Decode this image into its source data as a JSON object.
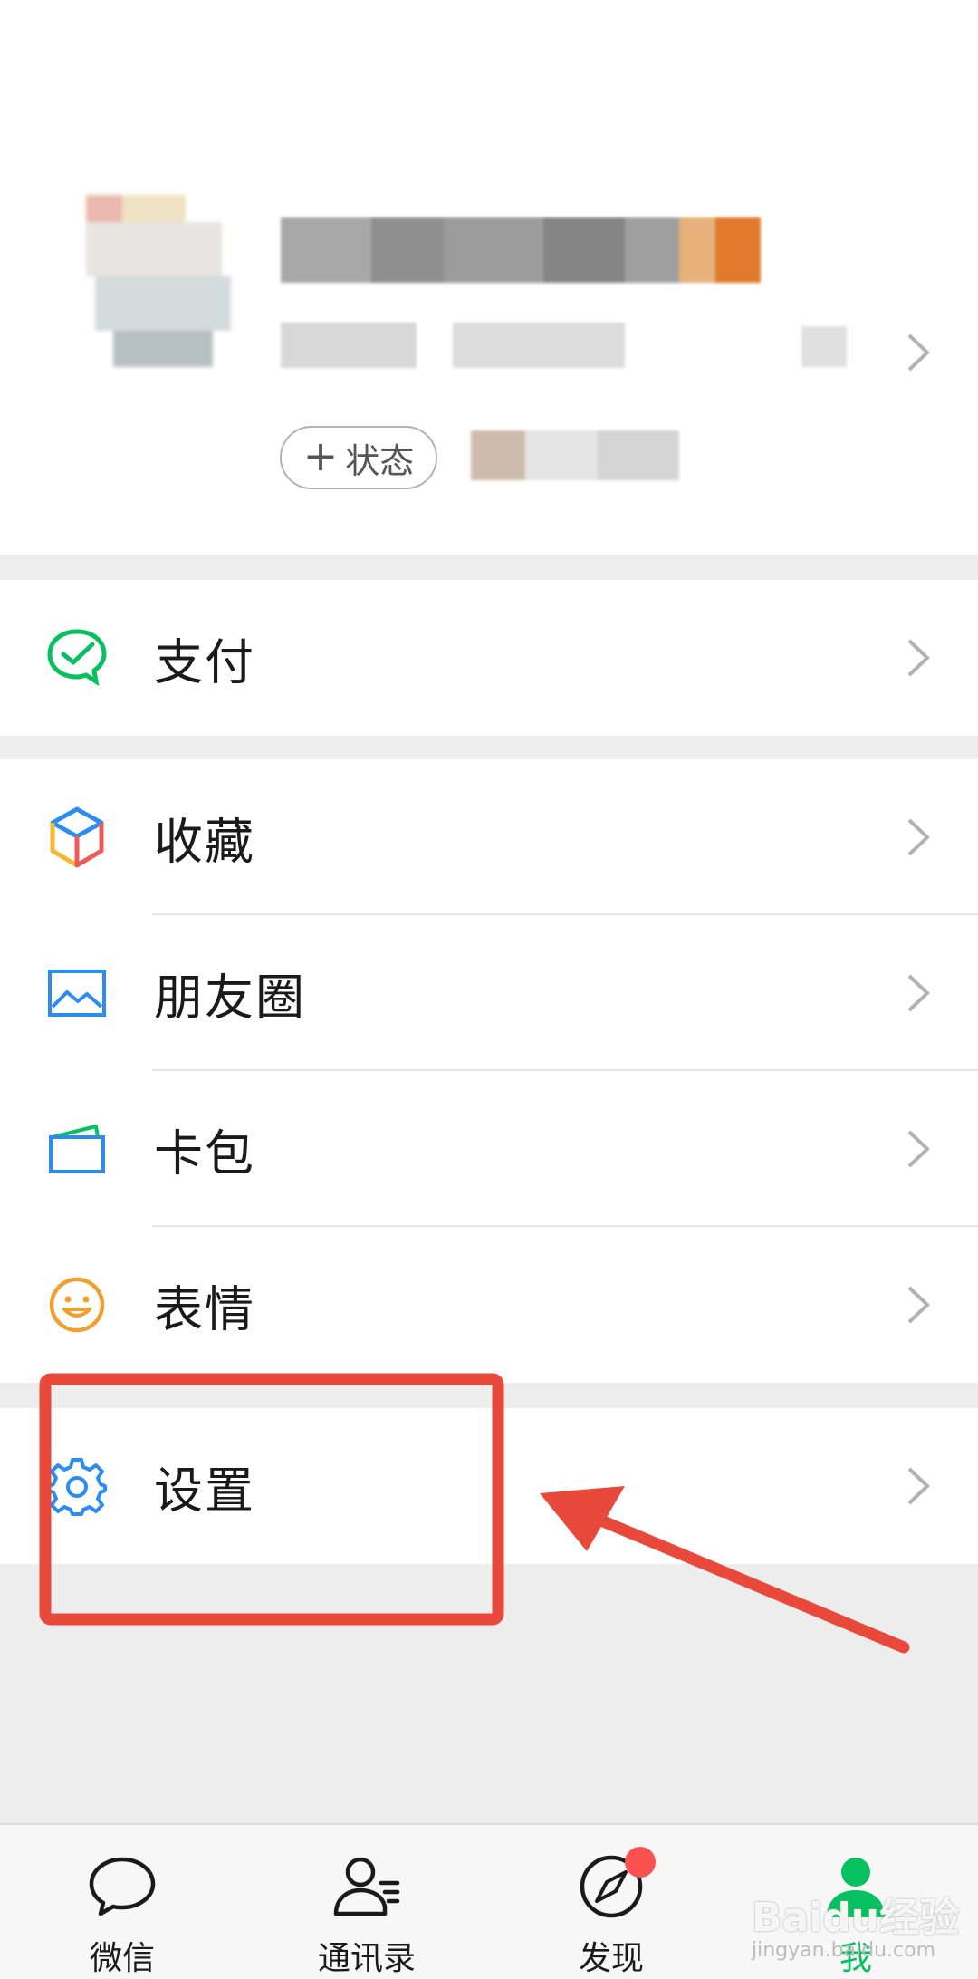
{
  "profile": {
    "status_label": "状态"
  },
  "menu": {
    "pay": "支付",
    "favorites": "收藏",
    "moments": "朋友圈",
    "cards": "卡包",
    "stickers": "表情",
    "settings": "设置"
  },
  "tabbar": {
    "chats": "微信",
    "contacts": "通讯录",
    "discover": "发现",
    "me": "我"
  },
  "watermark": {
    "brand": "Baidu经验",
    "url": "jingyan.baidu.com"
  },
  "colors": {
    "accent": "#07c160",
    "badge": "#fa5151",
    "annotation": "#e8493a"
  }
}
